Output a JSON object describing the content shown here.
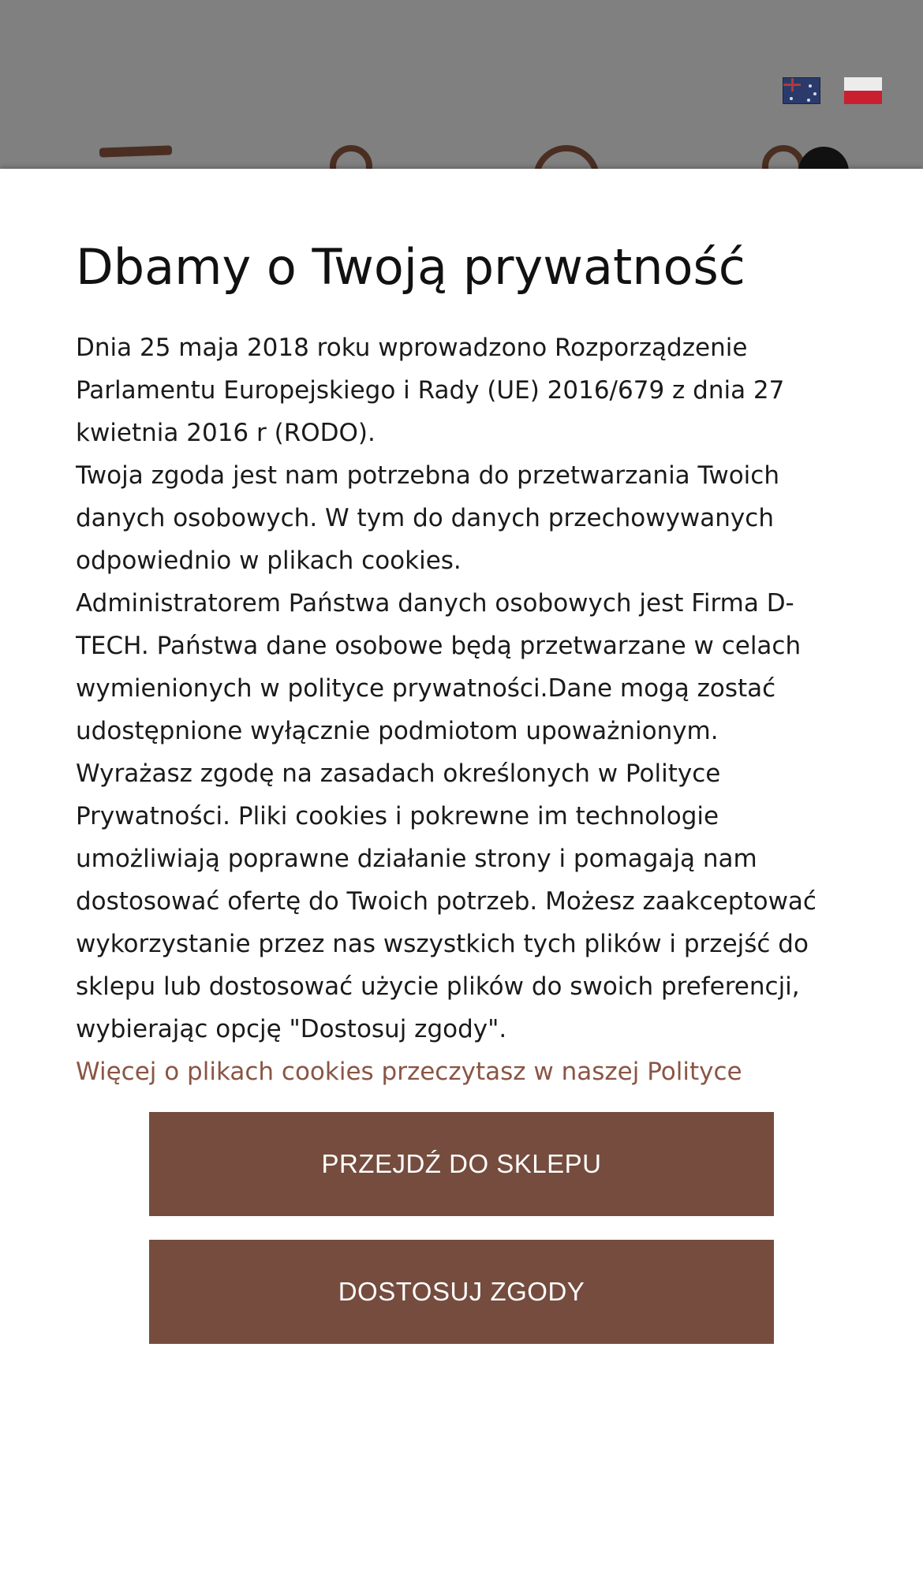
{
  "header": {
    "languages": [
      {
        "name": "english-flag-icon",
        "label": "English"
      },
      {
        "name": "polish-flag-icon",
        "label": "Polski"
      }
    ],
    "colors": {
      "overlay": "#808080",
      "brand_brown": "#4b2e22"
    }
  },
  "cookie_modal": {
    "title": "Dbamy o Twoją prywatność",
    "paragraphs": [
      "Dnia 25 maja 2018 roku wprowadzono Rozporządzenie Parlamentu Europejskiego i Rady (UE) 2016/679 z dnia 27 kwietnia 2016 r (RODO).",
      "Twoja zgoda jest nam potrzebna do  przetwarzania Twoich danych osobowych. W tym do danych  przechowywanych odpowiednio w plikach cookies.",
      "Administratorem Państwa danych osobowych jest Firma D-TECH. Państwa dane osobowe będą przetwarzane w celach wymienionych w polityce prywatności.Dane mogą zostać udostępnione wyłącznie podmiotom upoważnionym.",
      "Wyrażasz zgodę na zasadach określonych w Polityce Prywatności. Pliki cookies i pokrewne im technologie umożliwiają poprawne działanie strony i pomagają nam dostosować ofertę do Twoich potrzeb. Możesz zaakceptować wykorzystanie przez nas wszystkich tych plików i przejść do sklepu lub dostosować użycie plików do swoich preferencji, wybierając opcję \"Dostosuj zgody\"."
    ],
    "policy_link": "Więcej o plikach cookies przeczytasz w naszej Polityce",
    "accept_button": "PRZEJDŹ DO SKLEPU",
    "customize_button": "DOSTOSUJ ZGODY",
    "colors": {
      "button": "#754c3e",
      "link": "#8a5544"
    }
  }
}
